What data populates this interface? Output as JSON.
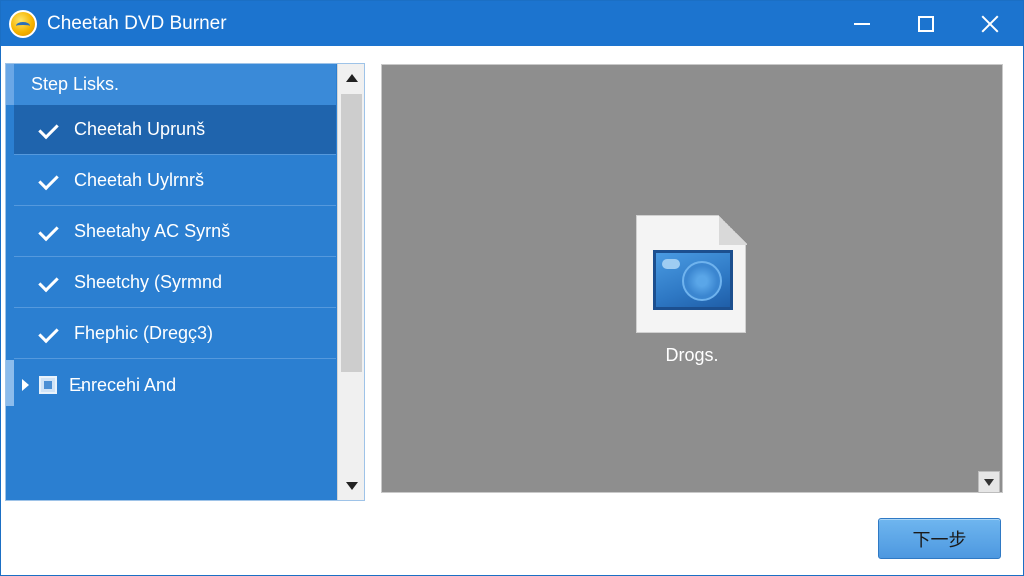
{
  "window": {
    "title": "Cheetah DVD Burner",
    "app_icon": "cheetah-app-icon",
    "controls": [
      "minimize-icon",
      "maximize-icon",
      "close-icon"
    ]
  },
  "list": {
    "header": "Step Lisks.",
    "items": [
      {
        "label": "Cheetah Uprunš",
        "checked": true,
        "selected": true
      },
      {
        "label": "Cheetah Uylrnrš",
        "checked": true,
        "selected": false
      },
      {
        "label": "Sheetahy AC Syrnš",
        "checked": true,
        "selected": false
      },
      {
        "label": "Sheetchy (Syrmnd",
        "checked": true,
        "selected": false
      },
      {
        "label": "Fhephic (Dregç3)",
        "checked": true,
        "selected": false
      },
      {
        "label": "E̵nrecehi And",
        "checked": false,
        "selected": false
      }
    ]
  },
  "preview": {
    "file_label": "Drogs.",
    "file_icon": "image-file-icon"
  },
  "footer": {
    "next_label": "下一步"
  },
  "colors": {
    "titlebar": "#1c74cf",
    "list_bg": "#2b7fd1",
    "selected_row": "#1f64ad",
    "preview_bg": "#8e8e8e",
    "button": "#5aa4e6"
  }
}
